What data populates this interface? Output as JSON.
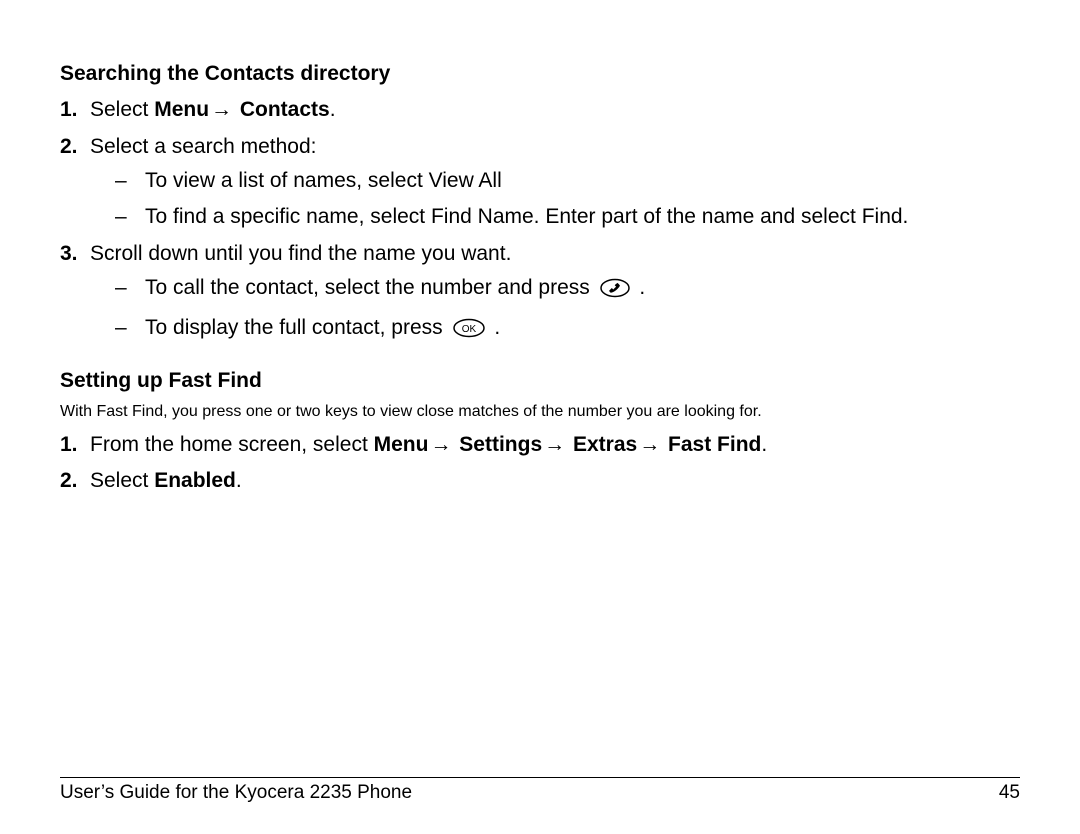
{
  "section1": {
    "heading": "Searching the Contacts directory",
    "step1_pre": "Select ",
    "step1_b1": "Menu",
    "step1_b2": " Contacts",
    "step1_post": ".",
    "step2": "Select a search method:",
    "step2_bullets": {
      "a": "To view a list of names, select View All",
      "b": "To find a specific name, select Find Name. Enter part of the name and select Find."
    },
    "step3": "Scroll down until you find the name you want.",
    "step3_bullets": {
      "a_pre": "To call the contact, select the number and press ",
      "a_post": ".",
      "b_pre": "To display the full contact, press ",
      "b_post": "."
    }
  },
  "section2": {
    "heading": "Setting up Fast Find",
    "intro": "With Fast Find, you press one or two keys to view close matches of the number you are looking for.",
    "step1_pre": "From the home screen, select ",
    "step1_b1": "Menu",
    "step1_b2": " Settings",
    "step1_b3": " Extras",
    "step1_b4": " Fast Find",
    "step1_post": ".",
    "step2_pre": "Select ",
    "step2_b": "Enabled",
    "step2_post": "."
  },
  "arrow": "→",
  "dash": "–",
  "markers": {
    "m1": "1.",
    "m2": "2.",
    "m3": "3."
  },
  "icons": {
    "call": "call-key-icon",
    "ok": "ok-key-icon"
  },
  "footer": {
    "title": "User’s Guide for the Kyocera 2235 Phone",
    "page": "45"
  }
}
